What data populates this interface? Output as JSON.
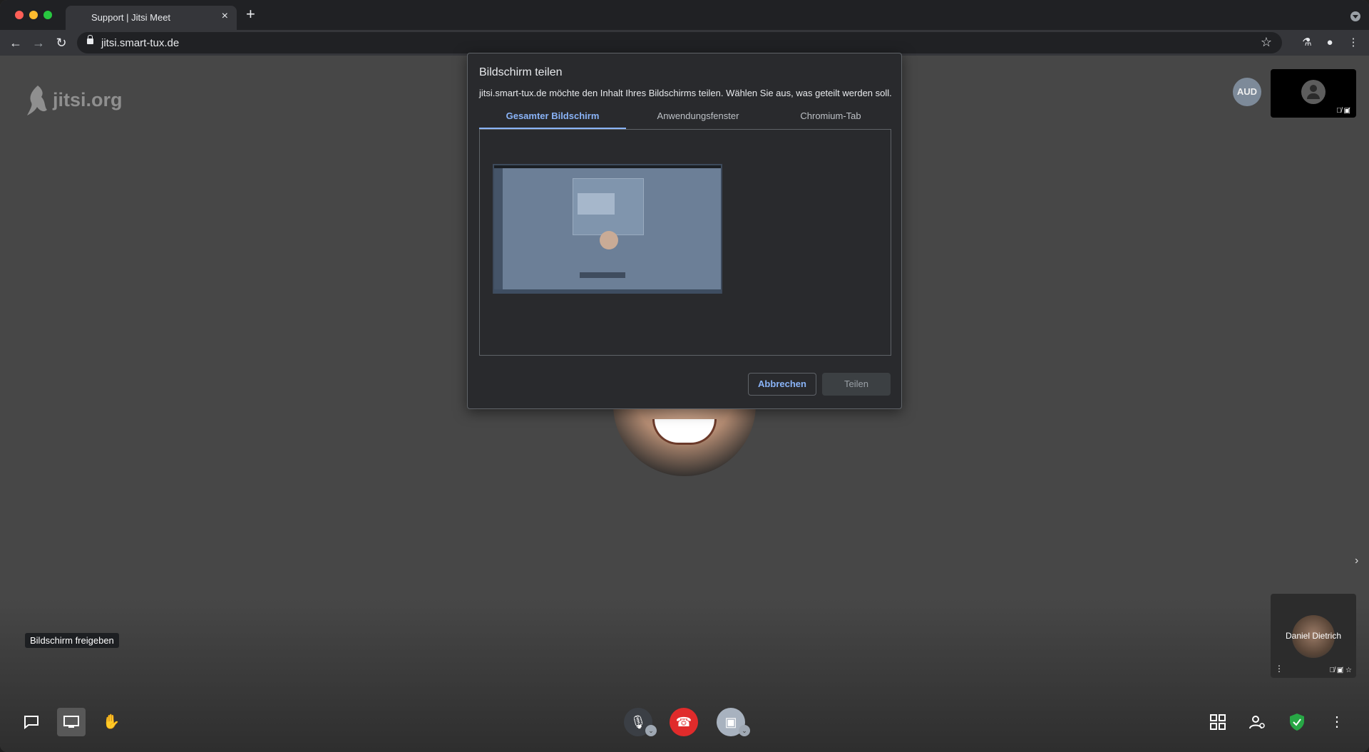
{
  "browser": {
    "tab_title": "Support | Jitsi Meet",
    "url": "jitsi.smart-tux.de"
  },
  "jitsi": {
    "logo_text": "jitsi.org",
    "remote_initials": "AUD",
    "local_name": "Daniel Dietrich",
    "tooltip": "Bildschirm freigeben"
  },
  "dialog": {
    "title": "Bildschirm teilen",
    "description": "jitsi.smart-tux.de möchte den Inhalt Ihres Bildschirms teilen. Wählen Sie aus, was geteilt werden soll.",
    "tabs": [
      {
        "label": "Gesamter Bildschirm",
        "selected": true
      },
      {
        "label": "Anwendungsfenster",
        "selected": false
      },
      {
        "label": "Chromium-Tab",
        "selected": false
      }
    ],
    "cancel_label": "Abbrechen",
    "share_label": "Teilen"
  },
  "colors": {
    "accent": "#8ab4f8",
    "hangup": "#e02b2b",
    "security_shield": "#27a745"
  },
  "icons": [
    "close-icon",
    "plus-icon",
    "back-icon",
    "forward-icon",
    "reload-icon",
    "lock-icon",
    "star-icon",
    "flask-icon",
    "profile-icon",
    "kebab-menu-icon",
    "chat-icon",
    "screen-share-icon",
    "raise-hand-icon",
    "mic-off-icon",
    "hangup-icon",
    "camera-off-icon",
    "tile-view-icon",
    "participants-icon",
    "shield-icon",
    "more-icon"
  ]
}
